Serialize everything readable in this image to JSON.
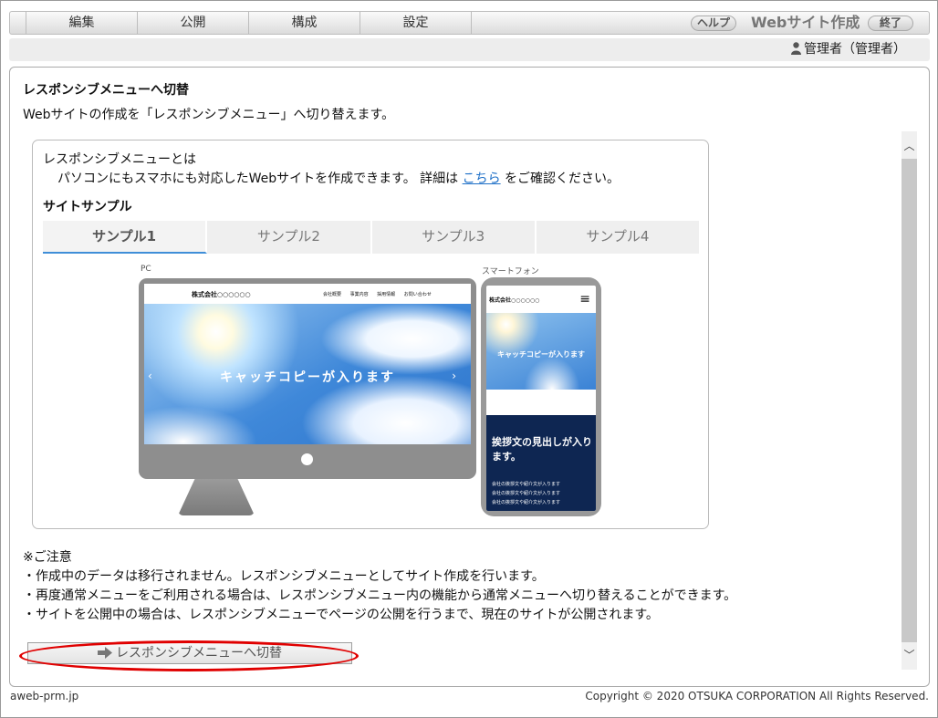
{
  "menu": {
    "items": [
      "編集",
      "公開",
      "構成",
      "設定"
    ],
    "help_label": "ヘルプ",
    "app_title": "Webサイト作成",
    "exit_label": "終了"
  },
  "user": {
    "name": "管理者（管理者）",
    "icon": "user-icon"
  },
  "page": {
    "title": "レスポンシブメニューへ切替",
    "description": "Webサイトの作成を「レスポンシブメニュー」へ切り替えます。"
  },
  "info": {
    "title": "レスポンシブメニューとは",
    "detail_prefix": "パソコンにもスマホにも対応したWebサイトを作成できます。 詳細は ",
    "link_text": "こちら",
    "detail_suffix": " をご確認ください。",
    "sample_heading": "サイトサンプル",
    "tabs": [
      "サンプル1",
      "サンプル2",
      "サンプル3",
      "サンプル4"
    ],
    "active_tab": 0
  },
  "preview": {
    "pc_label": "PC",
    "sp_label": "スマートフォン",
    "site_logo": "株式会社○○○○○○",
    "site_nav": "会社概要 事業内容 採用情報 お問い合わせ",
    "catch_copy": "キャッチコピーが入ります",
    "sp_heading": "挨拶文の見出しが入ります。",
    "sp_lines": [
      "会社の挨拶文や紹介文が入ります",
      "会社の挨拶文や紹介文が入ります",
      "会社の挨拶文や紹介文が入ります"
    ]
  },
  "notes": {
    "title": "※ご注意",
    "items": [
      "・作成中のデータは移行されません。レスポンシブメニューとしてサイト作成を行います。",
      "・再度通常メニューをご利用される場合は、レスポンシブメニュー内の機能から通常メニューへ切り替えることができます。",
      "・サイトを公開中の場合は、レスポンシブメニューでページの公開を行うまで、現在のサイトが公開されます。"
    ]
  },
  "action": {
    "switch_label": "レスポンシブメニューへ切替",
    "icon": "arrow-right-icon"
  },
  "footer": {
    "domain": "aweb-prm.jp",
    "copyright": "Copyright © 2020 OTSUKA CORPORATION All Rights Reserved."
  },
  "colors": {
    "link": "#1d6fc7",
    "tab_underline": "#3f8ed8",
    "highlight": "#e00000",
    "sp_dark": "#0e2652"
  }
}
